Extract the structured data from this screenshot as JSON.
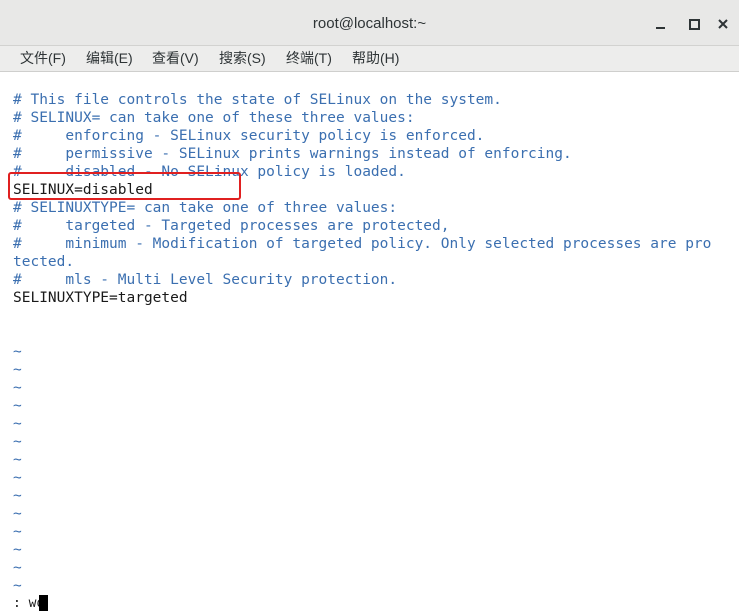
{
  "window": {
    "title": "root@localhost:~"
  },
  "menubar": {
    "items": [
      "文件(F)",
      "编辑(E)",
      "查看(V)",
      "搜索(S)",
      "终端(T)",
      "帮助(H)"
    ]
  },
  "editor": {
    "lines": [
      {
        "text": "# This file controls the state of SELinux on the system.",
        "kind": "comment"
      },
      {
        "text": "# SELINUX= can take one of these three values:",
        "kind": "comment"
      },
      {
        "text": "#     enforcing - SELinux security policy is enforced.",
        "kind": "comment"
      },
      {
        "text": "#     permissive - SELinux prints warnings instead of enforcing.",
        "kind": "comment"
      },
      {
        "text": "#     disabled - No SELinux policy is loaded.",
        "kind": "comment"
      },
      {
        "text": "SELINUX=disabled",
        "kind": "plain"
      },
      {
        "text": "# SELINUXTYPE= can take one of three values:",
        "kind": "comment"
      },
      {
        "text": "#     targeted - Targeted processes are protected,",
        "kind": "comment"
      },
      {
        "text": "#     minimum - Modification of targeted policy. Only selected processes are pro",
        "kind": "comment"
      },
      {
        "text": "tected.",
        "kind": "comment"
      },
      {
        "text": "#     mls - Multi Level Security protection.",
        "kind": "comment"
      },
      {
        "text": "SELINUXTYPE=targeted",
        "kind": "plain"
      },
      {
        "text": "",
        "kind": "plain"
      },
      {
        "text": "",
        "kind": "plain"
      }
    ],
    "empty_line_marker": "~",
    "empty_line_count": 14,
    "command_line": ": wq"
  },
  "colors": {
    "comment": "#3b6fb0",
    "plain": "#1a1a1a",
    "annotation": "#e02020"
  }
}
